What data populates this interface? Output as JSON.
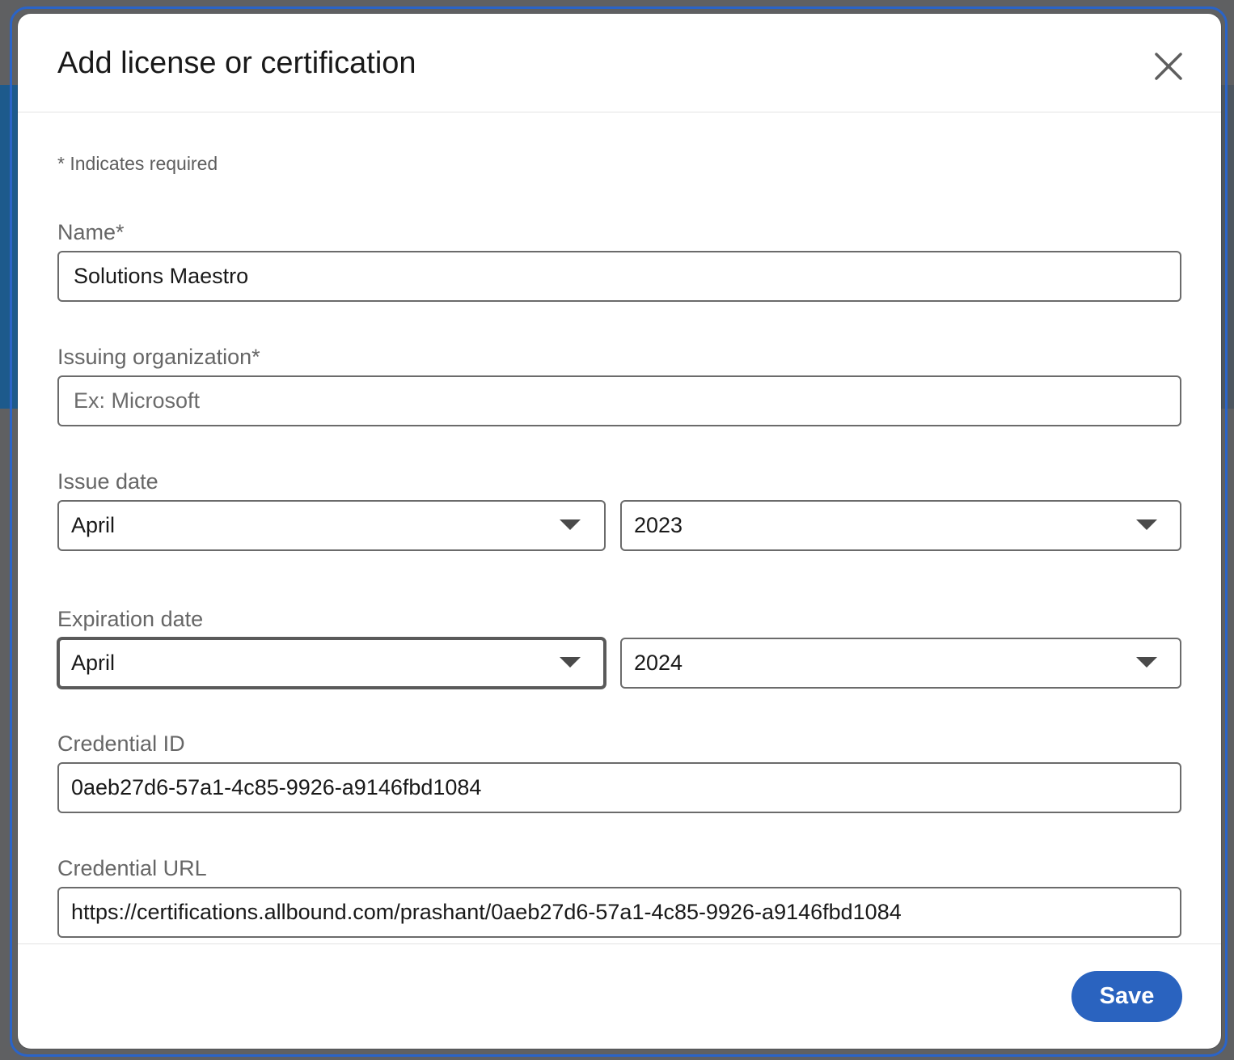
{
  "modal": {
    "title": "Add license or certification",
    "close_icon": "close-icon"
  },
  "form": {
    "required_note": "* Indicates required",
    "name": {
      "label": "Name*",
      "value": "Solutions Maestro"
    },
    "issuing_organization": {
      "label": "Issuing organization*",
      "placeholder": "Ex: Microsoft",
      "value": ""
    },
    "issue_date": {
      "label": "Issue date",
      "month": "April",
      "year": "2023"
    },
    "expiration_date": {
      "label": "Expiration date",
      "month": "April",
      "year": "2024"
    },
    "credential_id": {
      "label": "Credential ID",
      "value": "0aeb27d6-57a1-4c85-9926-a9146fbd1084"
    },
    "credential_url": {
      "label": "Credential URL",
      "value": "https://certifications.allbound.com/prashant/0aeb27d6-57a1-4c85-9926-a9146fbd1084"
    }
  },
  "footer": {
    "save_label": "Save"
  },
  "colors": {
    "primary_button": "#2a63bf",
    "focus_ring": "#2a64c8",
    "backdrop": "#5f6062"
  }
}
